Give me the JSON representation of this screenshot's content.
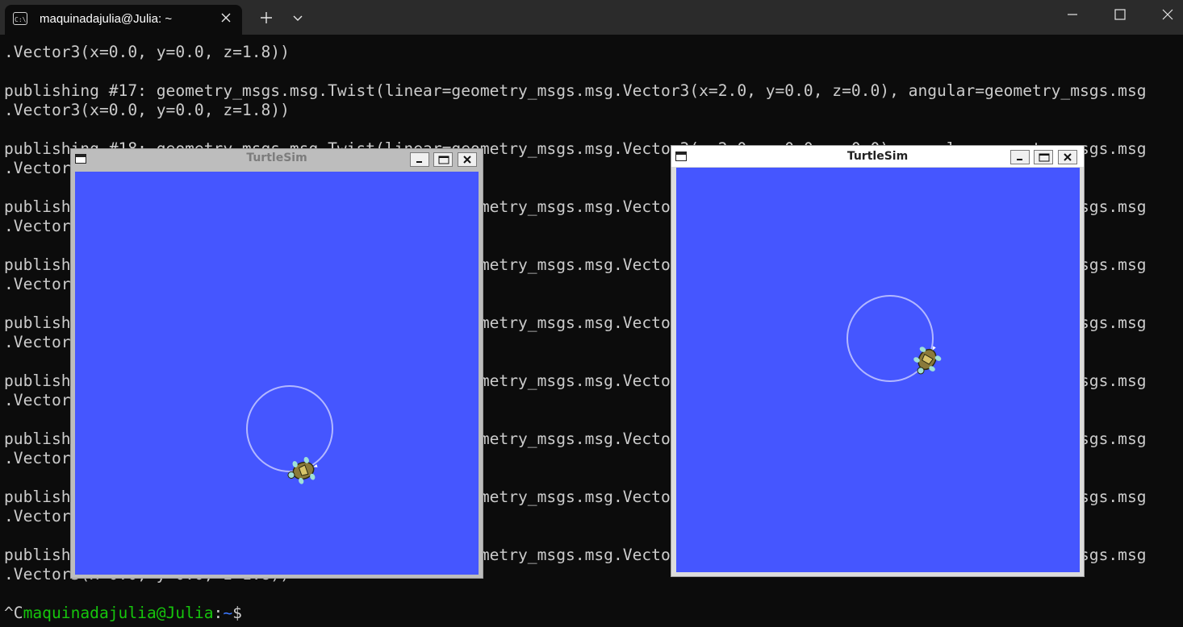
{
  "terminal": {
    "tab_title": "maquinadajulia@Julia: ~",
    "lines": [
      ".Vector3(x=0.0, y=0.0, z=1.8))",
      "",
      "publishing #17: geometry_msgs.msg.Twist(linear=geometry_msgs.msg.Vector3(x=2.0, y=0.0, z=0.0), angular=geometry_msgs.msg",
      ".Vector3(x=0.0, y=0.0, z=1.8))",
      "",
      "publishing #18: geometry_msgs.msg.Twist(linear=geometry_msgs.msg.Vector3(x=2.0, y=0.0, z=0.0), angular=geometry_msgs.msg",
      ".Vector3(x=0.0, y=0.0, z=1.8))",
      "",
      "publishing #19: geometry_msgs.msg.Twist(linear=geometry_msgs.msg.Vector3(x=2.0, y=0.0, z=0.0), angular=geometry_msgs.msg",
      ".Vector3(x=0.0, y=0.0, z=1.8))",
      "",
      "publishing #20: geometry_msgs.msg.Twist(linear=geometry_msgs.msg.Vector3(x=2.0, y=0.0, z=0.0), angular=geometry_msgs.msg",
      ".Vector3(x=0.0, y=0.0, z=1.8))",
      "",
      "publishing #21: geometry_msgs.msg.Twist(linear=geometry_msgs.msg.Vector3(x=2.0, y=0.0, z=0.0), angular=geometry_msgs.msg",
      ".Vector3(x=0.0, y=0.0, z=1.8))",
      "",
      "publishing #22: geometry_msgs.msg.Twist(linear=geometry_msgs.msg.Vector3(x=2.0, y=0.0, z=0.0), angular=geometry_msgs.msg",
      ".Vector3(x=0.0, y=0.0, z=1.8))",
      "",
      "publishing #23: geometry_msgs.msg.Twist(linear=geometry_msgs.msg.Vector3(x=2.0, y=0.0, z=0.0), angular=geometry_msgs.msg",
      ".Vector3(x=0.0, y=0.0, z=1.8))",
      "",
      "publishing #24: geometry_msgs.msg.Twist(linear=geometry_msgs.msg.Vector3(x=2.0, y=0.0, z=0.0), angular=geometry_msgs.msg",
      ".Vector3(x=0.0, y=0.0, z=1.8))",
      "",
      "publishing #25: geometry_msgs.msg.Twist(linear=geometry_msgs.msg.Vector3(x=2.0, y=0.0, z=0.0), angular=geometry_msgs.msg",
      ".Vector3(x=0.0, y=0.0, z=1.8))"
    ],
    "prompt": {
      "interrupt": "^C",
      "user_host": "maquinadajulia@Julia",
      "separator": ":",
      "path": "~",
      "symbol": "$"
    }
  },
  "turtlesim_windows": [
    {
      "title": "TurtleSim",
      "active": false
    },
    {
      "title": "TurtleSim",
      "active": true
    }
  ],
  "colors": {
    "terminal_bg": "#0c0c0c",
    "terminal_text": "#cccccc",
    "prompt_user": "#16c60c",
    "prompt_path": "#3b78ff",
    "turtlesim_bg": "#4556ff",
    "trail": "#b3b8ff"
  },
  "icons": {
    "tab": "terminal-icon",
    "tab_close": "close-icon",
    "new_tab": "plus-icon",
    "tab_menu": "chevron-down-icon",
    "minimize": "minimize-icon",
    "maximize": "maximize-icon",
    "close": "close-icon"
  }
}
